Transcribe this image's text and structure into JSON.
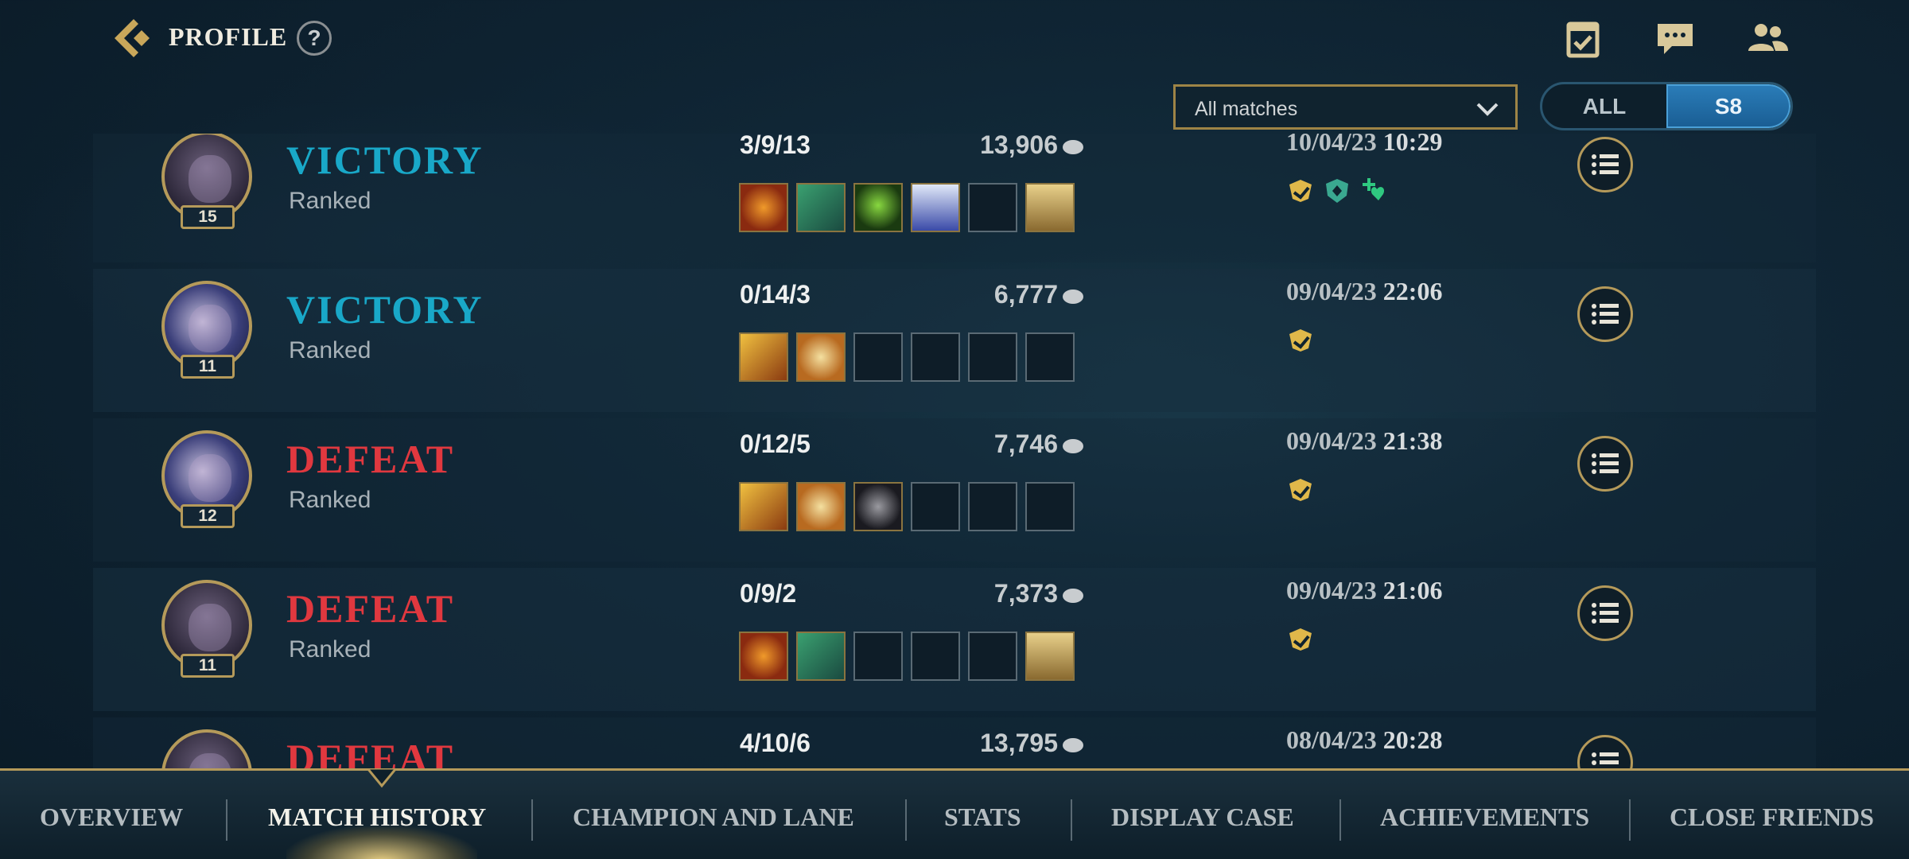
{
  "header": {
    "title": "PROFILE",
    "help_label": "?",
    "icons": [
      "missions-icon",
      "chat-icon",
      "friends-icon"
    ]
  },
  "filters": {
    "match_type_selected": "All matches",
    "season_options": [
      "ALL",
      "S8"
    ],
    "season_selected": "S8"
  },
  "colors": {
    "victory": "#19a8c8",
    "defeat": "#e0383f",
    "gold_accent": "#b59a5a",
    "toggle_active": "#1a5e94"
  },
  "matches": [
    {
      "champion_level": "15",
      "result": "VICTORY",
      "mode": "Ranked",
      "kda": "3/9/13",
      "gold": "13,906",
      "items": [
        "fire",
        "green",
        "hood",
        "cloak",
        "empty",
        "armor"
      ],
      "date": "10/04/23",
      "time": "10:29",
      "badges": [
        "mvp-badge-icon",
        "shield-badge-icon",
        "heal-badge-icon"
      ]
    },
    {
      "champion_level": "11",
      "result": "VICTORY",
      "mode": "Ranked",
      "kda": "0/14/3",
      "gold": "6,777",
      "items": [
        "blade",
        "wing",
        "empty",
        "empty",
        "empty",
        "empty"
      ],
      "date": "09/04/23",
      "time": "22:06",
      "badges": [
        "mvp-badge-icon"
      ]
    },
    {
      "champion_level": "12",
      "result": "DEFEAT",
      "mode": "Ranked",
      "kda": "0/12/5",
      "gold": "7,746",
      "items": [
        "blade",
        "wing",
        "gauntlet",
        "empty",
        "empty",
        "empty"
      ],
      "date": "09/04/23",
      "time": "21:38",
      "badges": [
        "mvp-badge-icon"
      ]
    },
    {
      "champion_level": "11",
      "result": "DEFEAT",
      "mode": "Ranked",
      "kda": "0/9/2",
      "gold": "7,373",
      "items": [
        "fire",
        "green",
        "empty",
        "empty",
        "empty",
        "armor"
      ],
      "date": "09/04/23",
      "time": "21:06",
      "badges": [
        "mvp-badge-icon"
      ]
    },
    {
      "champion_level": "",
      "result": "DEFEAT",
      "mode": "",
      "kda": "4/10/6",
      "gold": "13,795",
      "items": [],
      "date": "08/04/23",
      "time": "20:28",
      "badges": []
    }
  ],
  "nav": {
    "tabs": [
      "OVERVIEW",
      "MATCH HISTORY",
      "CHAMPION AND LANE",
      "STATS",
      "DISPLAY CASE",
      "ACHIEVEMENTS",
      "CLOSE FRIENDS"
    ],
    "active": "MATCH HISTORY"
  }
}
